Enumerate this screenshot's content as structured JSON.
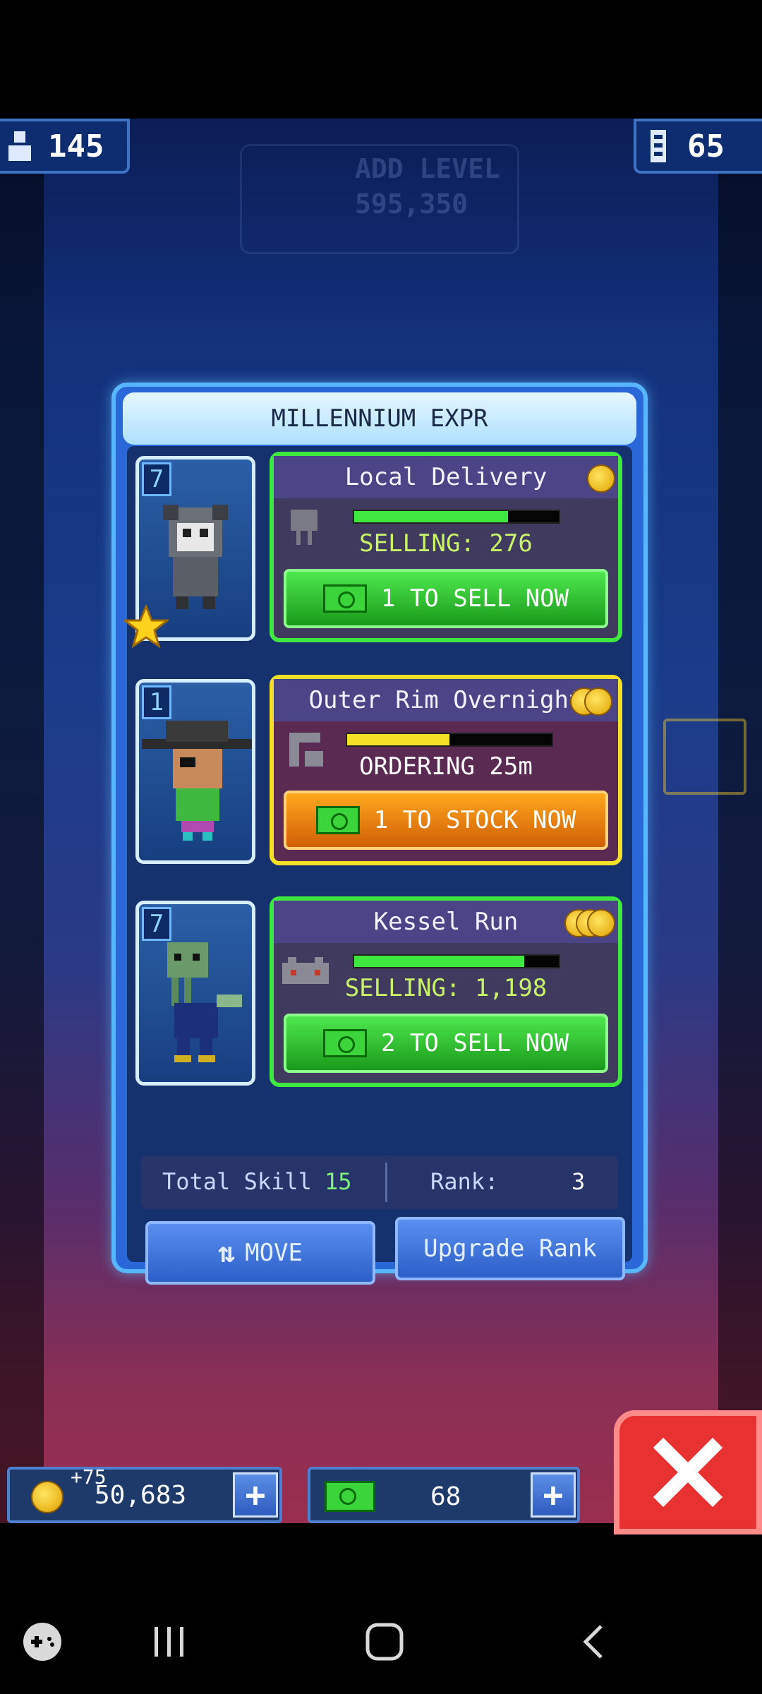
{
  "top": {
    "population": "145",
    "floors": "65"
  },
  "background": {
    "add_level_label": "ADD LEVEL",
    "add_level_cost": "595,350"
  },
  "dialog": {
    "title": "MILLENNIUM EXPR",
    "deliveries": [
      {
        "worker_level": "7",
        "name": "Local Delivery",
        "status": "SELLING: 276",
        "progress": 0.75,
        "button": "1 TO SELL NOW",
        "state": "selling",
        "coins": 1,
        "dream_job_star": true
      },
      {
        "worker_level": "1",
        "name": "Outer Rim Overnight",
        "status": "ORDERING 25m",
        "progress": 0.5,
        "button": "1 TO STOCK NOW",
        "state": "ordering",
        "coins": 2,
        "dream_job_star": false
      },
      {
        "worker_level": "7",
        "name": "Kessel Run",
        "status": "SELLING: 1,198",
        "progress": 0.83,
        "button": "2 TO SELL NOW",
        "state": "selling",
        "coins": 3,
        "dream_job_star": false
      }
    ],
    "total_skill_label": "Total Skill",
    "total_skill_value": "15",
    "rank_label": "Rank:",
    "rank_value": "3",
    "move_label": "MOVE",
    "upgrade_label": "Upgrade Rank"
  },
  "currency": {
    "coin_gain": "+75",
    "coins": "50,683",
    "bux": "68"
  },
  "colors": {
    "accent": "#2a67d8",
    "selling": "#3ee83e",
    "ordering": "#f5e028",
    "close": "#e83232"
  }
}
